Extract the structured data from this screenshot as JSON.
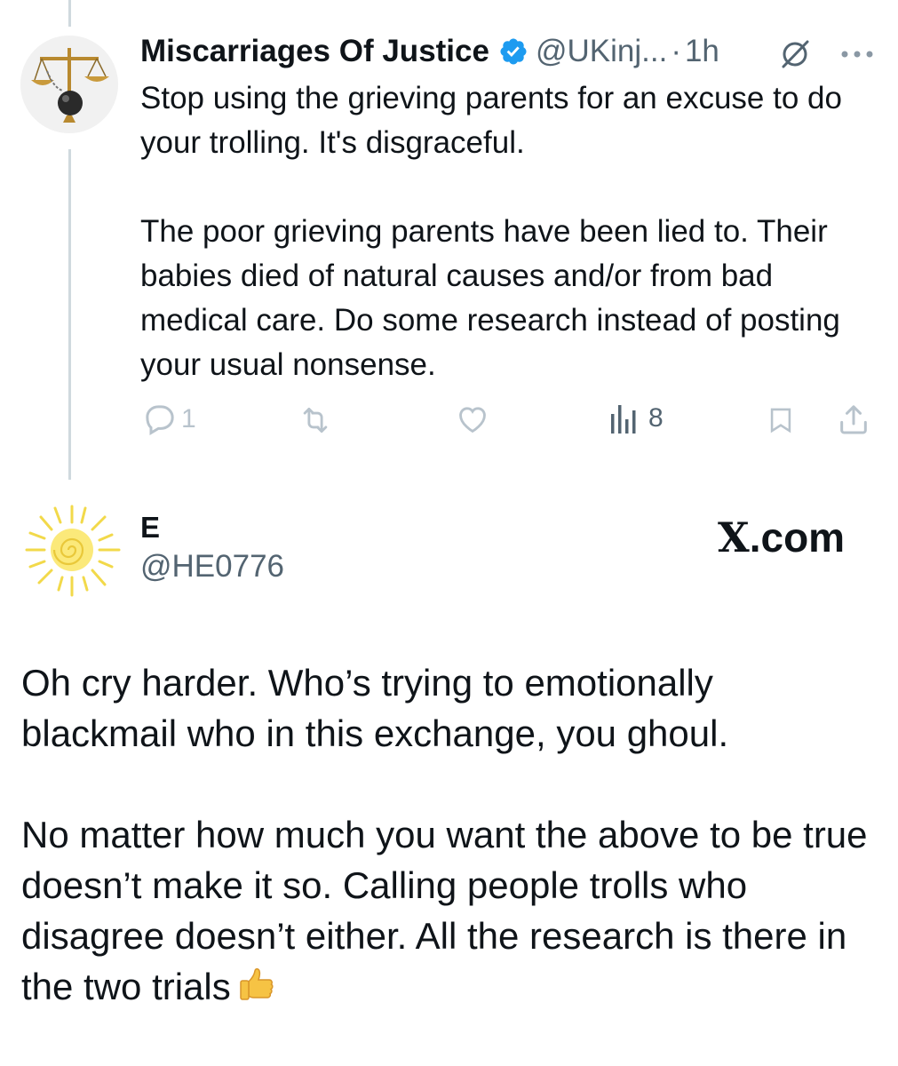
{
  "tweet1": {
    "display_name": "Miscarriages Of Justice",
    "handle": "@UKinj...",
    "separator": "·",
    "time": "1h",
    "verified_icon": "verified-badge-icon",
    "paragraph1": "Stop using the grieving parents for an excuse to do your trolling. It's disgraceful.",
    "paragraph2": "The poor grieving parents have been lied to. Their babies died of natural causes and/or from bad medical care. Do some research instead of posting your usual nonsense.",
    "reply_count": "1",
    "views_count": "8"
  },
  "tweet2": {
    "display_name": "E",
    "handle": "@HE0776",
    "paragraph1": "Oh cry harder. Who’s trying to emotionally blackmail who in this exchange, you ghoul.",
    "paragraph2": "No matter how much you want the above to be true doesn’t make it so. Calling people trolls who disagree doesn’t either. All the research is there in the two trials",
    "emoji": "thumbs-up-icon"
  },
  "watermark": {
    "x_letter": "X",
    "suffix": ".com"
  },
  "colors": {
    "verified": "#1d9bf0",
    "secondary_text": "#536471",
    "thread_line": "#cfd9de",
    "icon_gray": "#8a98a4"
  }
}
